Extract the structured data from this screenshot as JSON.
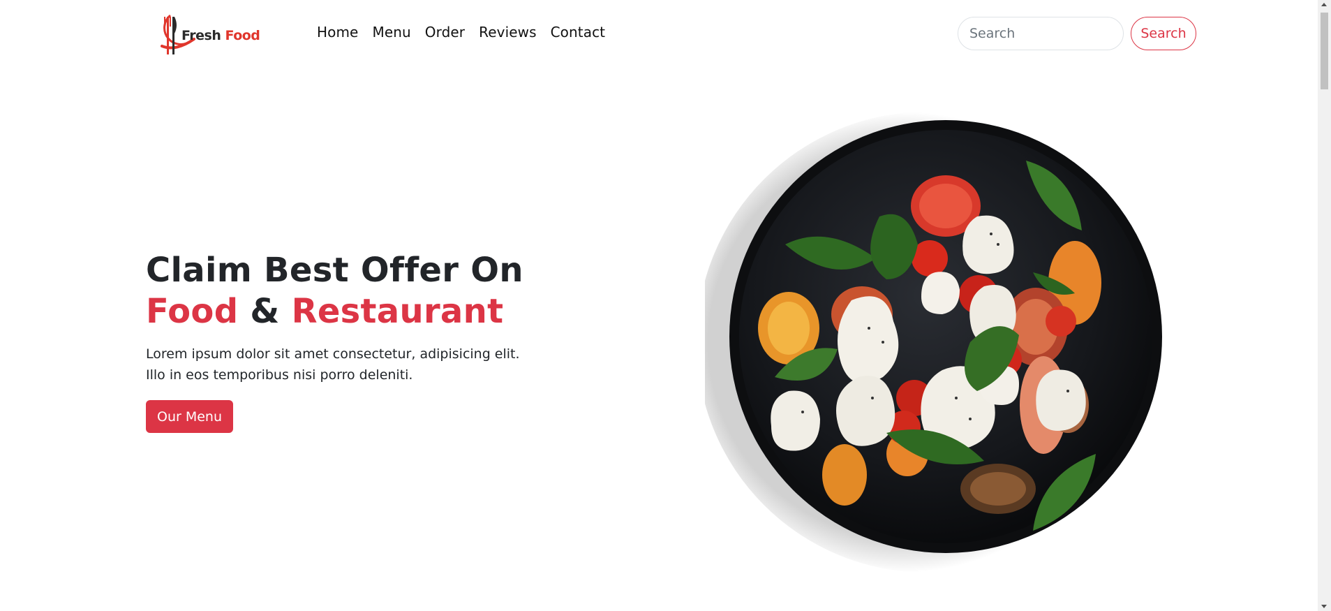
{
  "brand": {
    "name_part1": "Fresh",
    "name_part2": "Food",
    "accent_color": "#e0362c"
  },
  "nav": {
    "links": [
      "Home",
      "Menu",
      "Order",
      "Reviews",
      "Contact"
    ]
  },
  "search": {
    "placeholder": "Search",
    "button_label": "Search"
  },
  "hero": {
    "title_line1": "Claim Best Offer On",
    "title_word1": "Food",
    "title_amp": "&",
    "title_word2": "Restaurant",
    "description": "Lorem ipsum dolor sit amet consectetur, adipisicing elit. Illo in eos temporibus nisi porro deleniti.",
    "button_label": "Our Menu",
    "accent_color": "#dc3545"
  },
  "image": {
    "icon": "salad-plate-image"
  }
}
